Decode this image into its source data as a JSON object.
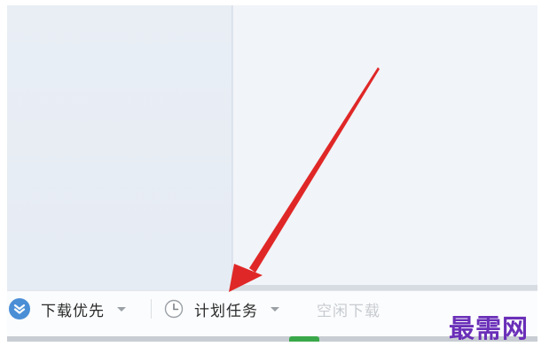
{
  "status_bar": {
    "download_priority": {
      "label": "下载优先",
      "icon": "chevron-down-circle-icon"
    },
    "scheduled_tasks": {
      "label": "计划任务",
      "icon": "clock-icon"
    },
    "idle_download": {
      "label": "空闲下载",
      "state": "disabled"
    }
  },
  "watermark": {
    "text": "最需网"
  },
  "colors": {
    "accent_blue": "#4a8fd6",
    "arrow_red": "#e02727",
    "watermark_purple": "#6a2fb8"
  }
}
